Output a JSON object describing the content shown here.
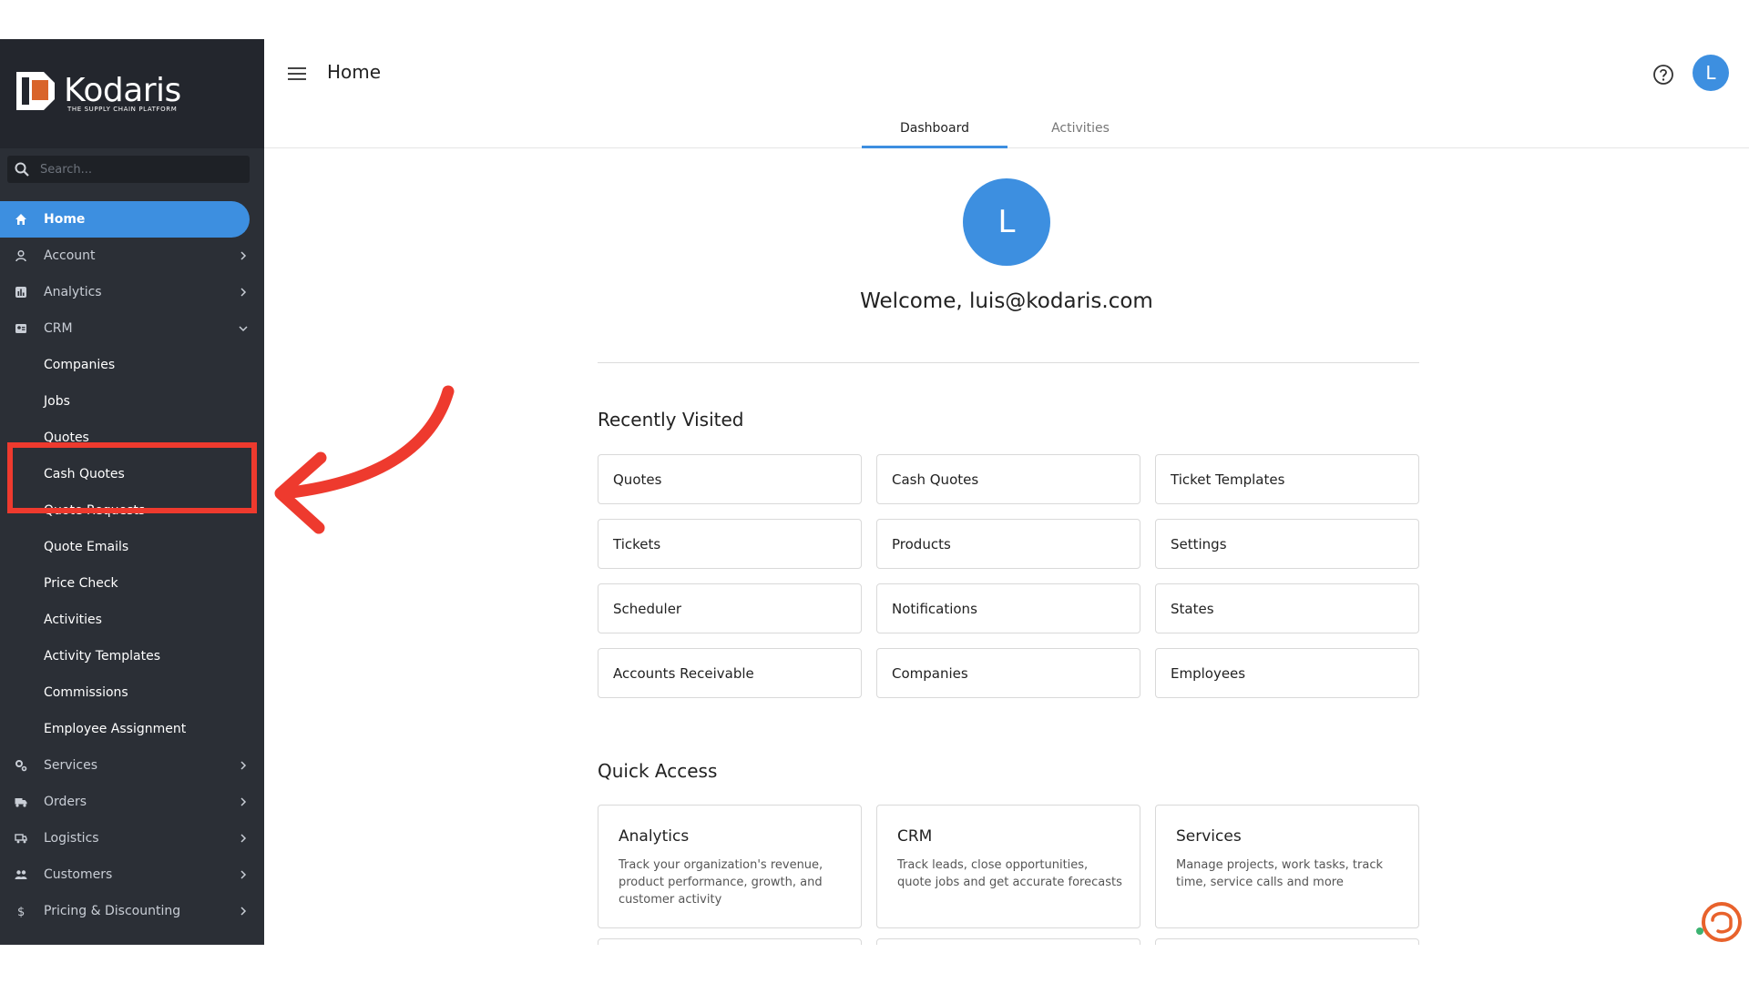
{
  "brand": {
    "name": "Kodaris",
    "tagline": "THE SUPPLY CHAIN PLATFORM",
    "accent": "#3d8fe0",
    "sidebar_bg": "#2b2f36",
    "highlight": "#ee3a2e"
  },
  "search": {
    "placeholder": "Search..."
  },
  "sidebar": {
    "items": [
      {
        "label": "Home",
        "icon": "home-icon",
        "active": true
      },
      {
        "label": "Account",
        "icon": "user-icon",
        "chevron": "right"
      },
      {
        "label": "Analytics",
        "icon": "analytics-icon",
        "chevron": "right"
      },
      {
        "label": "CRM",
        "icon": "crm-icon",
        "chevron": "down"
      }
    ],
    "crm_sub": [
      "Companies",
      "Jobs",
      "Quotes",
      "Cash Quotes",
      "Quote Requests",
      "Quote Emails",
      "Price Check",
      "Activities",
      "Activity Templates",
      "Commissions",
      "Employee Assignment"
    ],
    "more_items": [
      {
        "label": "Services",
        "icon": "gears-icon",
        "chevron": "right"
      },
      {
        "label": "Orders",
        "icon": "truck-icon",
        "chevron": "right"
      },
      {
        "label": "Logistics",
        "icon": "logistics-icon",
        "chevron": "right"
      },
      {
        "label": "Customers",
        "icon": "customers-icon",
        "chevron": "right"
      },
      {
        "label": "Pricing & Discounting",
        "icon": "dollar-icon",
        "chevron": "right"
      }
    ]
  },
  "header": {
    "title": "Home",
    "avatar_initial": "L",
    "tabs": [
      {
        "label": "Dashboard",
        "active": true
      },
      {
        "label": "Activities",
        "active": false
      }
    ]
  },
  "welcome": {
    "avatar_initial": "L",
    "text": "Welcome, luis@kodaris.com"
  },
  "recently_visited": {
    "title": "Recently Visited",
    "items": [
      "Quotes",
      "Cash Quotes",
      "Ticket Templates",
      "Tickets",
      "Products",
      "Settings",
      "Scheduler",
      "Notifications",
      "States",
      "Accounts Receivable",
      "Companies",
      "Employees"
    ]
  },
  "quick_access": {
    "title": "Quick Access",
    "items": [
      {
        "title": "Analytics",
        "desc": "Track your organization's revenue, product performance, growth, and customer activity"
      },
      {
        "title": "CRM",
        "desc": "Track leads, close opportunities, quote jobs and get accurate forecasts"
      },
      {
        "title": "Services",
        "desc": "Manage projects, work tasks, track time, service calls and more"
      }
    ]
  }
}
